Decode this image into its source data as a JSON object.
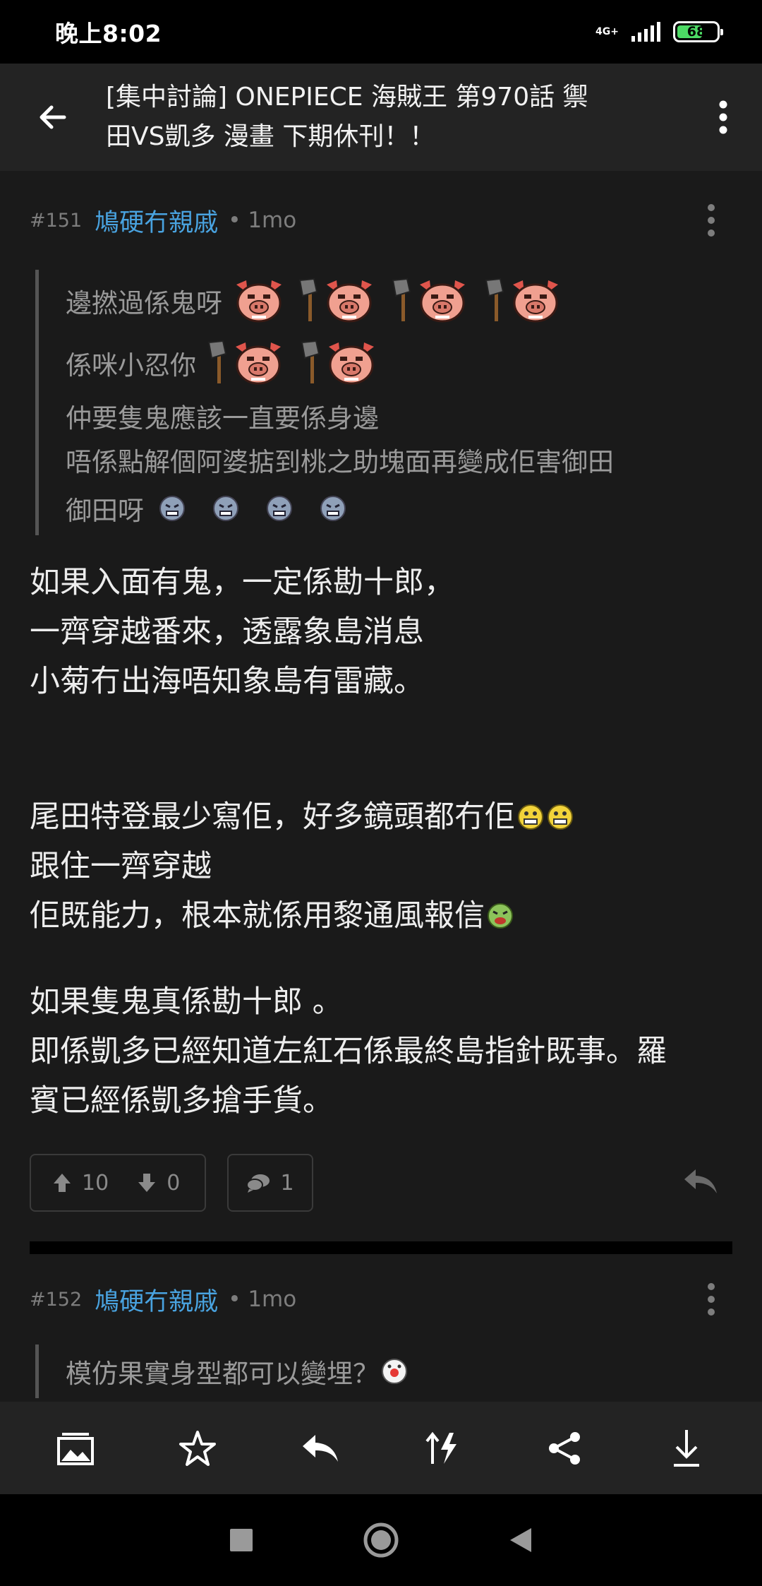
{
  "status": {
    "time": "晚上8:02",
    "network": "4G+",
    "battery": "68",
    "battery_color": "#4cd964"
  },
  "header": {
    "title_line1": "[集中討論] ONEPIECE 海賊王 第970話 禦",
    "title_line2": "田VS凱多 漫畫 下期休刊！！",
    "back_icon": "arrow-left-icon",
    "more_icon": "more-vert-icon"
  },
  "colors": {
    "author": "#49a3e0",
    "background": "#1a1a1a",
    "toolbar": "#232323"
  },
  "posts": [
    {
      "floor": "#151",
      "author": "鳩硬冇親戚",
      "time": "• 1mo",
      "quote": [
        "邊撚過係鬼呀",
        "係咪小忍你",
        "仲要隻鬼應該一直要係身邊",
        "唔係點解個阿婆掂到桃之助塊面再變成佢害御田",
        "御田呀"
      ],
      "body": [
        "如果入面有鬼，一定係勘十郎，",
        "一齊穿越番來，透露象島消息",
        "小菊冇出海唔知象島有雷藏。",
        "尾田特登最少寫佢，好多鏡頭都冇佢",
        "跟住一齊穿越",
        "佢既能力，根本就係用黎通風報信",
        "如果隻鬼真係勘十郎 。",
        "即係凱多已經知道左紅石係最終島指針既事。羅",
        "賓已經係凱多搶手貨。"
      ],
      "upvotes": "10",
      "downvotes": "0",
      "comments": "1"
    },
    {
      "floor": "#152",
      "author": "鳩硬冇親戚",
      "time": "• 1mo",
      "quote": [
        "模仿果實身型都可以變埋？"
      ]
    }
  ],
  "toolbar": {
    "items": [
      "image-icon",
      "star-icon",
      "reply-icon",
      "sort-icon",
      "share-icon",
      "download-icon"
    ]
  },
  "navbar": {
    "items": [
      "recent-apps-icon",
      "home-icon",
      "back-icon"
    ]
  }
}
